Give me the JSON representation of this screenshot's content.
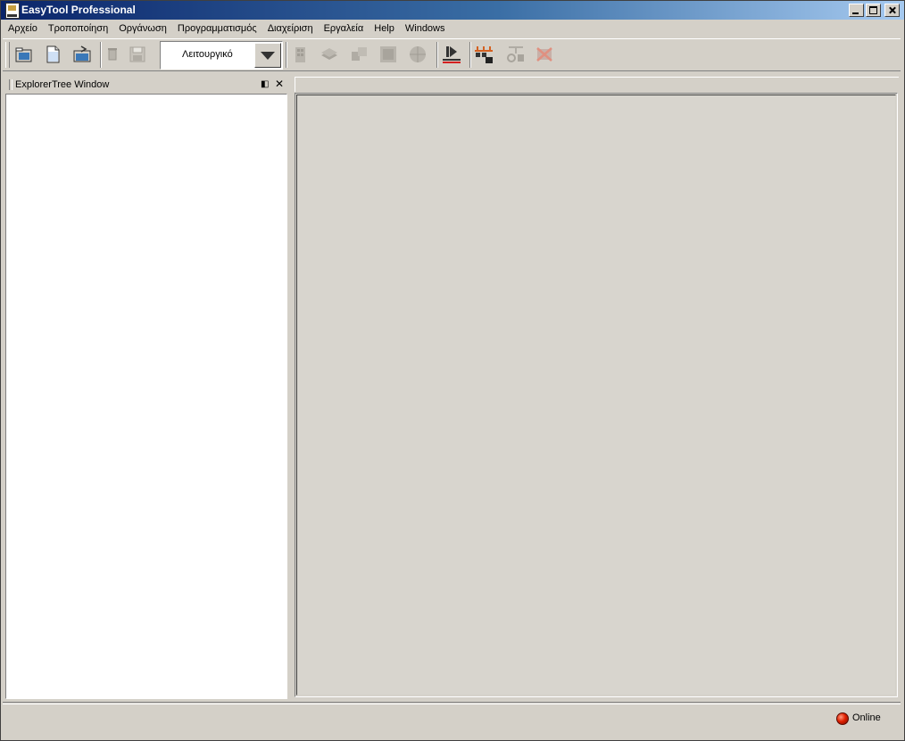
{
  "window": {
    "title": "EasyTool Professional"
  },
  "menu": {
    "items": [
      "Αρχείο",
      "Τροποποίηση",
      "Οργάνωση",
      "Προγραμματισμός",
      "Διαχείριση",
      "Εργαλεία",
      "Help",
      "Windows"
    ]
  },
  "toolbar": {
    "mode_selected": "Λειτουργικό",
    "buttons": [
      {
        "icon": "open-folder-icon",
        "enabled": true
      },
      {
        "icon": "new-document-icon",
        "enabled": true
      },
      {
        "icon": "open-project-icon",
        "enabled": true
      },
      {
        "icon": "trash-icon",
        "enabled": false
      },
      {
        "icon": "save-icon",
        "enabled": false
      },
      {
        "icon": "building-icon",
        "enabled": false
      },
      {
        "icon": "layers-icon",
        "enabled": false
      },
      {
        "icon": "rooms-icon",
        "enabled": false
      },
      {
        "icon": "square-icon",
        "enabled": false
      },
      {
        "icon": "globe-icon",
        "enabled": false
      },
      {
        "icon": "play-record-icon",
        "enabled": true
      },
      {
        "icon": "device-network-icon",
        "enabled": true
      },
      {
        "icon": "device-settings-icon",
        "enabled": false
      },
      {
        "icon": "device-delete-icon",
        "enabled": false
      }
    ]
  },
  "explorer": {
    "title": "ExplorerTree Window"
  },
  "status": {
    "connection": "Online",
    "led_color": "#e02000"
  }
}
